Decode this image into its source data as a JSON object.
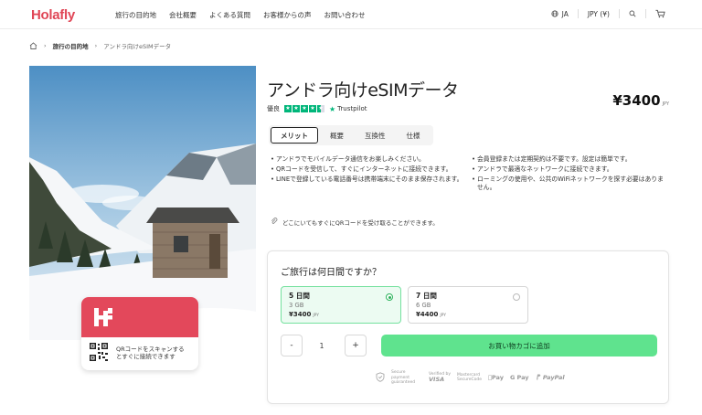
{
  "header": {
    "logo": "Holafly",
    "nav": [
      "旅行の目的地",
      "会社概要",
      "よくある質問",
      "お客様からの声",
      "お問い合わせ"
    ],
    "language": "JA",
    "currency": "JPY (¥)"
  },
  "breadcrumb": {
    "items": [
      "旅行の目的地",
      "アンドラ向けeSIMデータ"
    ]
  },
  "hero_card": {
    "qr_text": "QRコードをスキャンするとすぐに接続できます"
  },
  "product": {
    "title": "アンドラ向けeSIMデータ",
    "rating_label": "優良",
    "trustpilot": "Trustpilot",
    "price": "¥3400",
    "price_unit": "JPY",
    "tabs": [
      "メリット",
      "概要",
      "互換性",
      "仕様"
    ],
    "features_left": [
      "アンドラでモバイルデータ通信をお楽しみください。",
      "QRコードを受信して、すぐにインターネットに接続できます。",
      "LINEで登録している電話番号は携帯端末にそのまま保存されます。"
    ],
    "features_right": [
      "会員登録または定期契約は不要です。設定は簡単です。",
      "アンドラで最適なネットワークに接続できます。",
      "ローミングの使用や、公共のWiFiネットワークを探す必要はありません。"
    ],
    "qr_note": "どこにいてもすぐにQRコードを受け取ることができます。"
  },
  "booking": {
    "title": "ご旅行は何日間ですか？",
    "plans": [
      {
        "days": "5 日間",
        "data": "3 GB",
        "price": "¥3400",
        "unit": "JPY",
        "selected": true
      },
      {
        "days": "7 日間",
        "data": "6 GB",
        "price": "¥4400",
        "unit": "JPY",
        "selected": false
      }
    ],
    "minus": "-",
    "quantity": "1",
    "plus": "+",
    "cart_button": "お買い物カゴに追加",
    "payments": {
      "secure": "Secure payment guaranteed",
      "verified_by": "Verified by",
      "visa": "VISA",
      "mastercard": "Mastercard",
      "securecode": "SecureCode",
      "applepay": "Pay",
      "gpay": "G Pay",
      "paypal": "PayPal"
    }
  }
}
